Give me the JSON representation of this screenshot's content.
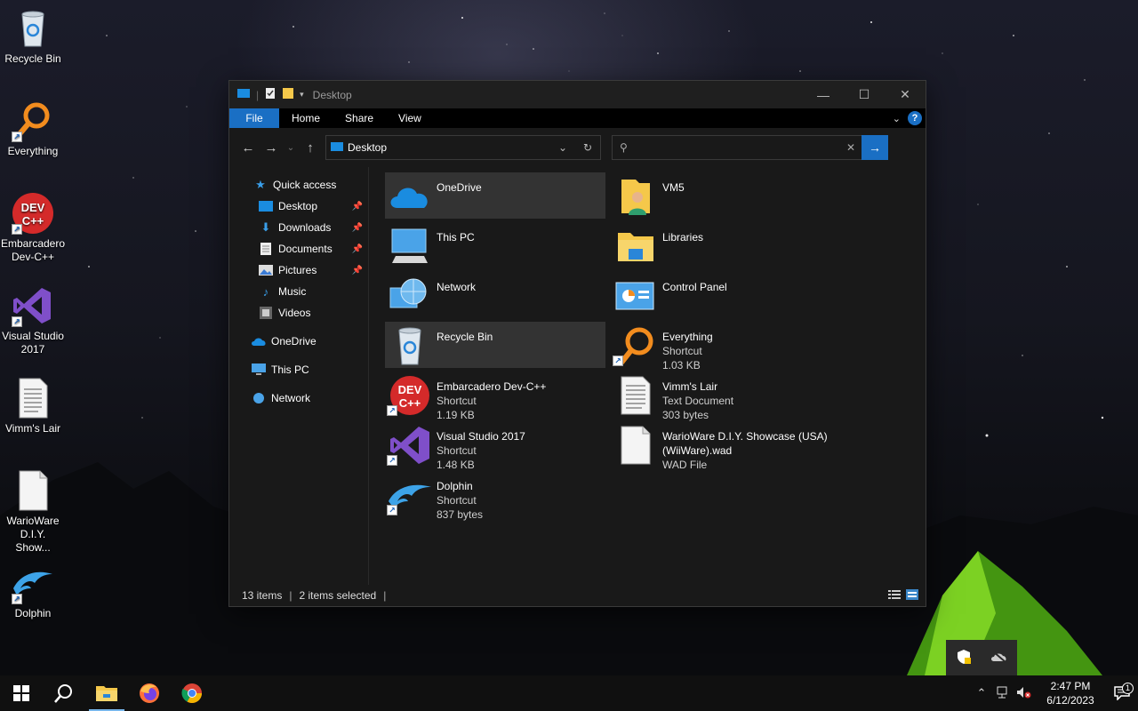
{
  "desktop": {
    "icons": [
      {
        "label": "Recycle Bin",
        "icon": "recycle-bin-icon",
        "shortcut": false
      },
      {
        "label": "Everything",
        "icon": "everything-icon",
        "shortcut": true
      },
      {
        "label": "Embarcadero Dev-C++",
        "icon": "devcpp-icon",
        "shortcut": true
      },
      {
        "label": "Visual Studio 2017",
        "icon": "visual-studio-icon",
        "shortcut": true
      },
      {
        "label": "Vimm's Lair",
        "icon": "text-document-icon",
        "shortcut": false
      },
      {
        "label": "WarioWare D.I.Y. Show...",
        "icon": "file-icon",
        "shortcut": false
      },
      {
        "label": "Dolphin",
        "icon": "dolphin-icon",
        "shortcut": true
      }
    ]
  },
  "window": {
    "title": "Desktop",
    "ribbon_tabs": [
      "File",
      "Home",
      "Share",
      "View"
    ],
    "address": "Desktop",
    "search_placeholder": "",
    "help": "?",
    "nav_pane": {
      "quick_access": "Quick access",
      "pinned": [
        "Desktop",
        "Downloads",
        "Documents",
        "Pictures"
      ],
      "unpinned": [
        "Music",
        "Videos"
      ],
      "onedrive": "OneDrive",
      "this_pc": "This PC",
      "network": "Network"
    },
    "items": [
      {
        "name": "OneDrive",
        "line2": "",
        "line3": "",
        "icon": "onedrive-icon",
        "selected": true
      },
      {
        "name": "VM5",
        "line2": "",
        "line3": "",
        "icon": "user-folder-icon",
        "selected": false
      },
      {
        "name": "This PC",
        "line2": "",
        "line3": "",
        "icon": "this-pc-icon",
        "selected": false
      },
      {
        "name": "Libraries",
        "line2": "",
        "line3": "",
        "icon": "libraries-icon",
        "selected": false
      },
      {
        "name": "Network",
        "line2": "",
        "line3": "",
        "icon": "network-icon",
        "selected": false
      },
      {
        "name": "Control Panel",
        "line2": "",
        "line3": "",
        "icon": "control-panel-icon",
        "selected": false
      },
      {
        "name": "Recycle Bin",
        "line2": "",
        "line3": "",
        "icon": "recycle-bin-icon",
        "selected": true
      },
      {
        "name": "Everything",
        "line2": "Shortcut",
        "line3": "1.03 KB",
        "icon": "everything-icon",
        "selected": false
      },
      {
        "name": "Embarcadero Dev-C++",
        "line2": "Shortcut",
        "line3": "1.19 KB",
        "icon": "devcpp-icon",
        "selected": false
      },
      {
        "name": "Vimm's Lair",
        "line2": "Text Document",
        "line3": "303 bytes",
        "icon": "text-document-icon",
        "selected": false
      },
      {
        "name": "Visual Studio 2017",
        "line2": "Shortcut",
        "line3": "1.48 KB",
        "icon": "visual-studio-icon",
        "selected": false
      },
      {
        "name": "WarioWare D.I.Y. Showcase (USA)",
        "line2": "(WiiWare).wad",
        "line3": "WAD File",
        "icon": "file-icon",
        "selected": false
      },
      {
        "name": "Dolphin",
        "line2": "Shortcut",
        "line3": "837 bytes",
        "icon": "dolphin-icon",
        "selected": false
      }
    ],
    "status": {
      "count": "13 items",
      "selected": "2 items selected"
    }
  },
  "taskbar": {
    "time": "2:47 PM",
    "date": "6/12/2023",
    "notification_count": "1"
  },
  "colors": {
    "accent": "#1a6fc4",
    "window_bg": "#191919",
    "selection": "#333333"
  }
}
